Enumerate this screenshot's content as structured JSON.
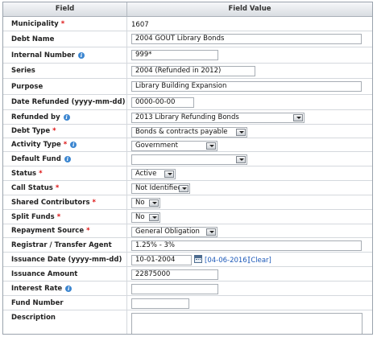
{
  "header": {
    "field": "Field",
    "field_value": "Field Value"
  },
  "rows": {
    "municipality": {
      "label": "Municipality",
      "required": "*",
      "value": "1607"
    },
    "debt_name": {
      "label": "Debt Name",
      "value": "2004 GOUT Library Bonds"
    },
    "internal_number": {
      "label": "Internal Number",
      "value": "999*"
    },
    "series": {
      "label": "Series",
      "value": "2004 (Refunded in 2012)"
    },
    "purpose": {
      "label": "Purpose",
      "value": "Library Building Expansion"
    },
    "date_refunded": {
      "label": "Date Refunded (yyyy-mm-dd)",
      "value": "0000-00-00"
    },
    "refunded_by": {
      "label": "Refunded by",
      "value": "2013 Library Refunding Bonds"
    },
    "debt_type": {
      "label": "Debt Type",
      "required": "*",
      "value": "Bonds & contracts payable"
    },
    "activity_type": {
      "label": "Activity Type",
      "required": "*",
      "value": "Government"
    },
    "default_fund": {
      "label": "Default Fund",
      "value": ""
    },
    "status": {
      "label": "Status",
      "required": "*",
      "value": "Active"
    },
    "call_status": {
      "label": "Call Status",
      "required": "*",
      "value": "Not Identified"
    },
    "shared_contributors": {
      "label": "Shared Contributors",
      "required": "*",
      "value": "No"
    },
    "split_funds": {
      "label": "Split Funds",
      "required": "*",
      "value": "No"
    },
    "repayment_source": {
      "label": "Repayment Source",
      "required": "*",
      "value": "General Obligation"
    },
    "registrar": {
      "label": "Registrar / Transfer Agent",
      "value": "1.25% - 3%"
    },
    "issuance_date": {
      "label": "Issuance Date (yyyy-mm-dd)",
      "value": "10-01-2004",
      "today_link": "[04-06-2016]",
      "clear_link": "[Clear]"
    },
    "issuance_amount": {
      "label": "Issuance Amount",
      "value": "22875000"
    },
    "interest_rate": {
      "label": "Interest Rate",
      "value": ""
    },
    "fund_number": {
      "label": "Fund Number",
      "value": ""
    },
    "description": {
      "label": "Description",
      "value": ""
    }
  },
  "icons": {
    "info": "info-icon",
    "calendar": "calendar-icon",
    "dropdown": "chevron-down-icon"
  },
  "colors": {
    "required": "#dd1111",
    "link": "#1b58b8",
    "info": "#3c86d0"
  }
}
